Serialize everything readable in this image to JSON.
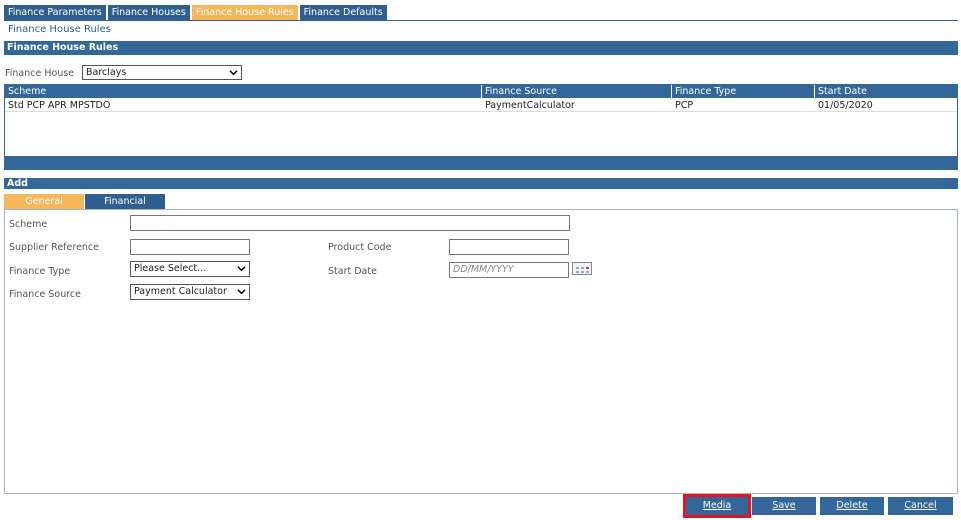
{
  "top_tabs": [
    {
      "label": "Finance Parameters",
      "active": false
    },
    {
      "label": "Finance Houses",
      "active": false
    },
    {
      "label": "Finance House Rules",
      "active": true
    },
    {
      "label": "Finance Defaults",
      "active": false
    }
  ],
  "page_title": "Finance House Rules",
  "section_title": "Finance House Rules",
  "finance_house": {
    "label": "Finance House",
    "value": "Barclays"
  },
  "grid": {
    "columns": [
      "Scheme",
      "Finance Source",
      "Finance Type",
      "Start Date"
    ],
    "rows": [
      [
        "Std PCP APR MPSTDO",
        "PaymentCalculator",
        "PCP",
        "01/05/2020"
      ]
    ]
  },
  "add_section": "Add",
  "inner_tabs": [
    {
      "label": "General",
      "active": true
    },
    {
      "label": "Financial",
      "active": false
    }
  ],
  "form": {
    "scheme_label": "Scheme",
    "scheme_value": "",
    "supplier_ref_label": "Supplier Reference",
    "supplier_ref_value": "",
    "product_code_label": "Product Code",
    "product_code_value": "",
    "finance_type_label": "Finance Type",
    "finance_type_value": "Please Select...",
    "start_date_label": "Start Date",
    "start_date_placeholder": "DD/MM/YYYY",
    "finance_source_label": "Finance Source",
    "finance_source_value": "Payment Calculator"
  },
  "buttons": {
    "media": "Media",
    "save": "Save",
    "delete": "Delete",
    "cancel": "Cancel"
  },
  "colors": {
    "header_blue": "#336699",
    "active_tab_orange": "#f6b65a",
    "highlight_red": "#e8131d"
  }
}
